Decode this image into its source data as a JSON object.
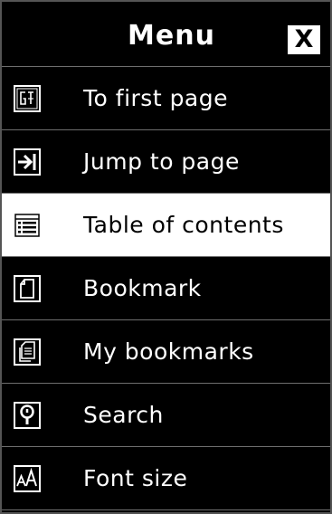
{
  "header": {
    "title": "Menu",
    "close_label": "X"
  },
  "items": [
    {
      "label": "To first page",
      "icon": "first-page-icon",
      "selected": false
    },
    {
      "label": "Jump to page",
      "icon": "jump-to-page-icon",
      "selected": false
    },
    {
      "label": "Table of contents",
      "icon": "table-of-contents-icon",
      "selected": true
    },
    {
      "label": "Bookmark",
      "icon": "bookmark-icon",
      "selected": false
    },
    {
      "label": "My bookmarks",
      "icon": "my-bookmarks-icon",
      "selected": false
    },
    {
      "label": "Search",
      "icon": "search-icon",
      "selected": false
    },
    {
      "label": "Font size",
      "icon": "font-size-icon",
      "selected": false
    }
  ],
  "colors": {
    "background": "#000000",
    "text": "#ffffff",
    "selected_background": "#ffffff",
    "selected_text": "#000000",
    "divider": "#6e6e6e"
  }
}
